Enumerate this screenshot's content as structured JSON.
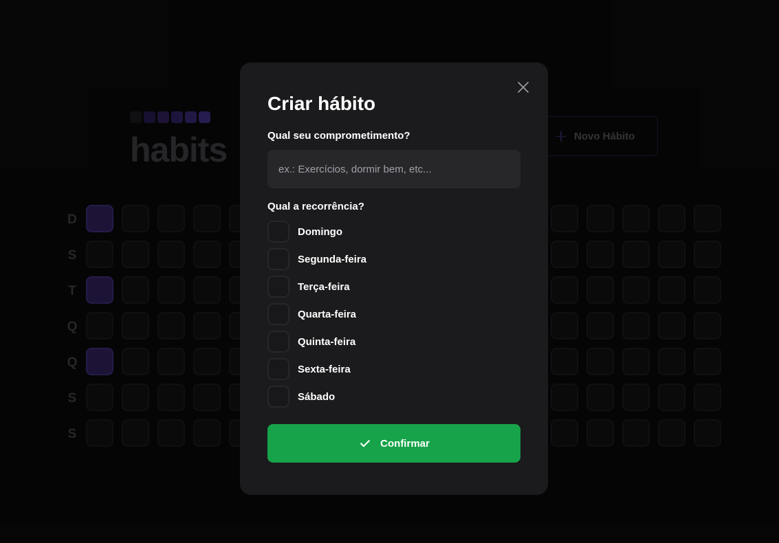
{
  "background": {
    "logo_text": "habits",
    "logo_square_colors": [
      "#1a1a1d",
      "#251a4a",
      "#2b1e55",
      "#2f2160",
      "#35266b",
      "#3b2b77"
    ],
    "new_habit_label": "Novo Hábito",
    "week_day_labels": [
      "D",
      "S",
      "T",
      "Q",
      "Q",
      "S",
      "S"
    ],
    "completed_cells": [
      0,
      2,
      4
    ]
  },
  "modal": {
    "title": "Criar hábito",
    "commitment_label": "Qual seu comprometimento?",
    "commitment_placeholder": "ex.: Exercícios, dormir bem, etc...",
    "commitment_value": "",
    "recurrence_label": "Qual a recorrência?",
    "weekdays": [
      {
        "label": "Domingo",
        "checked": false
      },
      {
        "label": "Segunda-feira",
        "checked": false
      },
      {
        "label": "Terça-feira",
        "checked": false
      },
      {
        "label": "Quarta-feira",
        "checked": false
      },
      {
        "label": "Quinta-feira",
        "checked": false
      },
      {
        "label": "Sexta-feira",
        "checked": false
      },
      {
        "label": "Sábado",
        "checked": false
      }
    ],
    "confirm_label": "Confirmar",
    "icons": {
      "close": "close-icon",
      "confirm": "check-icon"
    }
  },
  "colors": {
    "modal_bg": "#1b1b1d",
    "input_bg": "#27272a",
    "confirm_green": "#16a34a",
    "violet": "#2b1e55"
  }
}
